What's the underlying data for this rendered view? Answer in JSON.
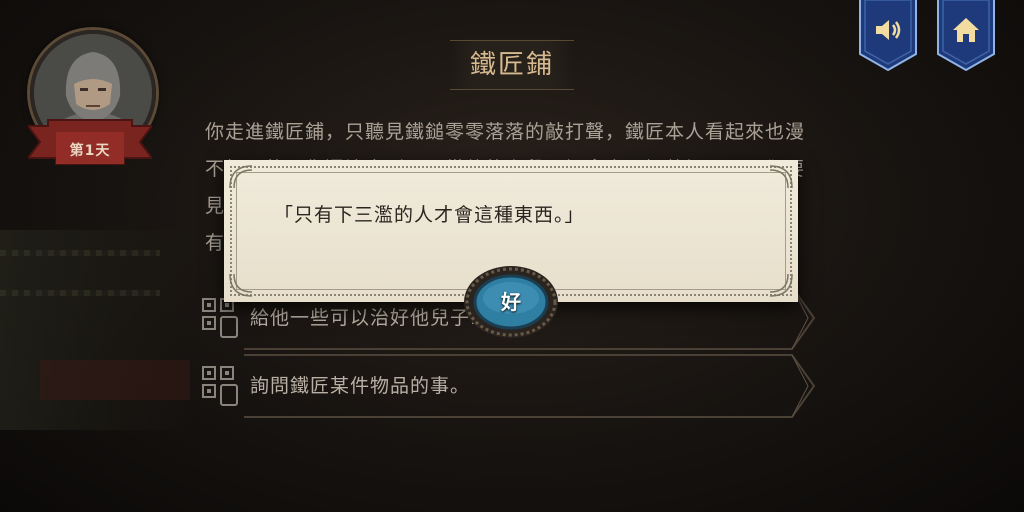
{
  "header": {
    "title": "鐵匠鋪",
    "day_label": "第1天"
  },
  "narrative": {
    "lines": [
      "你走進鐵匠鋪，只聽見鐵鎚零零落落的敲打聲，鐵匠本人看起來也漫",
      "不經心的，你還注意到，正從他的上段子裡拿東西調整坏，一面卻要",
      "見",
      "有"
    ]
  },
  "choices": [
    {
      "label": "給他一些可以治好他兒子…"
    },
    {
      "label": "詢問鐵匠某件物品的事。"
    }
  ],
  "dialog": {
    "text": "「只有下三濫的人才會這種東西。」",
    "ok_label": "好"
  },
  "icons": {
    "sound": "speaker-icon",
    "home": "home-icon",
    "choice": "qr-phone-icon"
  },
  "colors": {
    "banner_blue": "#1f3a7a",
    "banner_trim": "#8fb3e6",
    "ribbon_red": "#8a2a24",
    "ok_teal": "#2f7fa3"
  }
}
